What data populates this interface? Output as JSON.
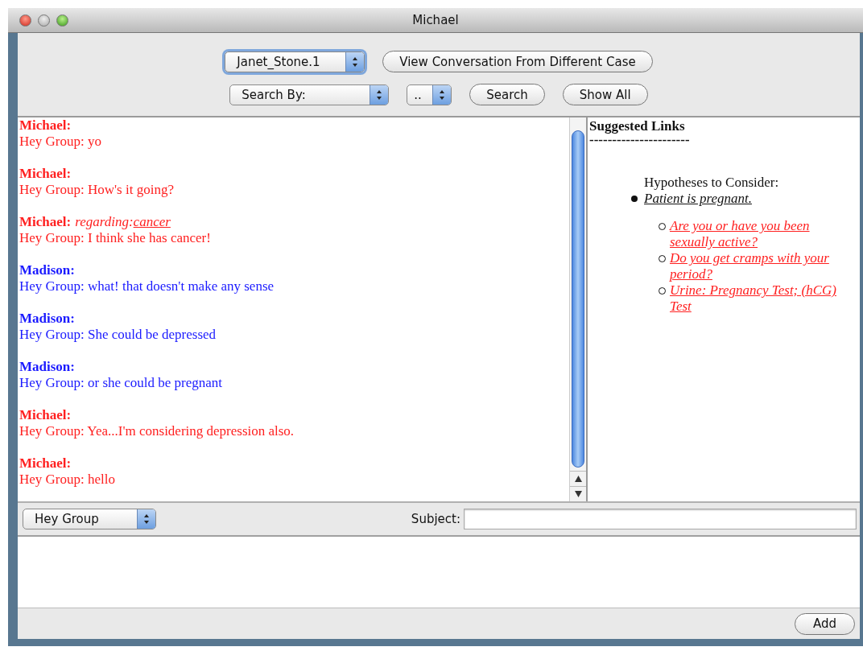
{
  "window": {
    "title": "Michael"
  },
  "case_select": {
    "value": "Janet_Stone.1"
  },
  "view_button": "View Conversation From Different Case",
  "search_by": {
    "value": "Search By:"
  },
  "search_value": {
    "value": ".."
  },
  "search_button": "Search",
  "show_all_button": "Show All",
  "messages": [
    {
      "sender": "Michael:",
      "color": "#ff2020",
      "text": "Hey Group: yo"
    },
    {
      "sender": "Michael:",
      "color": "#ff2020",
      "text": "Hey Group: How's it going?"
    },
    {
      "sender": "Michael:",
      "color": "#ff2020",
      "regarding": {
        "label": "regarding:",
        "topic": "cancer"
      },
      "text": "Hey Group: I think she has cancer!"
    },
    {
      "sender": "Madison:",
      "color": "#1a1aff",
      "text": "Hey Group: what! that doesn't make any sense"
    },
    {
      "sender": "Madison:",
      "color": "#1a1aff",
      "text": "Hey Group: She could be depressed"
    },
    {
      "sender": "Madison:",
      "color": "#1a1aff",
      "text": "Hey Group: or she could be pregnant"
    },
    {
      "sender": "Michael:",
      "color": "#ff2020",
      "text": "Hey Group: Yea...I'm considering depression also."
    },
    {
      "sender": "Michael:",
      "color": "#ff2020",
      "text": "Hey Group: hello"
    }
  ],
  "suggested": {
    "title": "Suggested Links",
    "rule": "----------------------",
    "heading": "Hypotheses to Consider:",
    "hypotheses": [
      {
        "text": "Patient is pregnant.",
        "children": [
          {
            "text": "Are you or have you been sexually active?"
          },
          {
            "text": "Do you get cramps with your period?"
          },
          {
            "text": "Urine: Pregnancy Test; (hCG) Test"
          }
        ]
      }
    ]
  },
  "recipient_select": {
    "value": "Hey Group"
  },
  "subject": {
    "label": "Subject:"
  },
  "add_button": "Add"
}
